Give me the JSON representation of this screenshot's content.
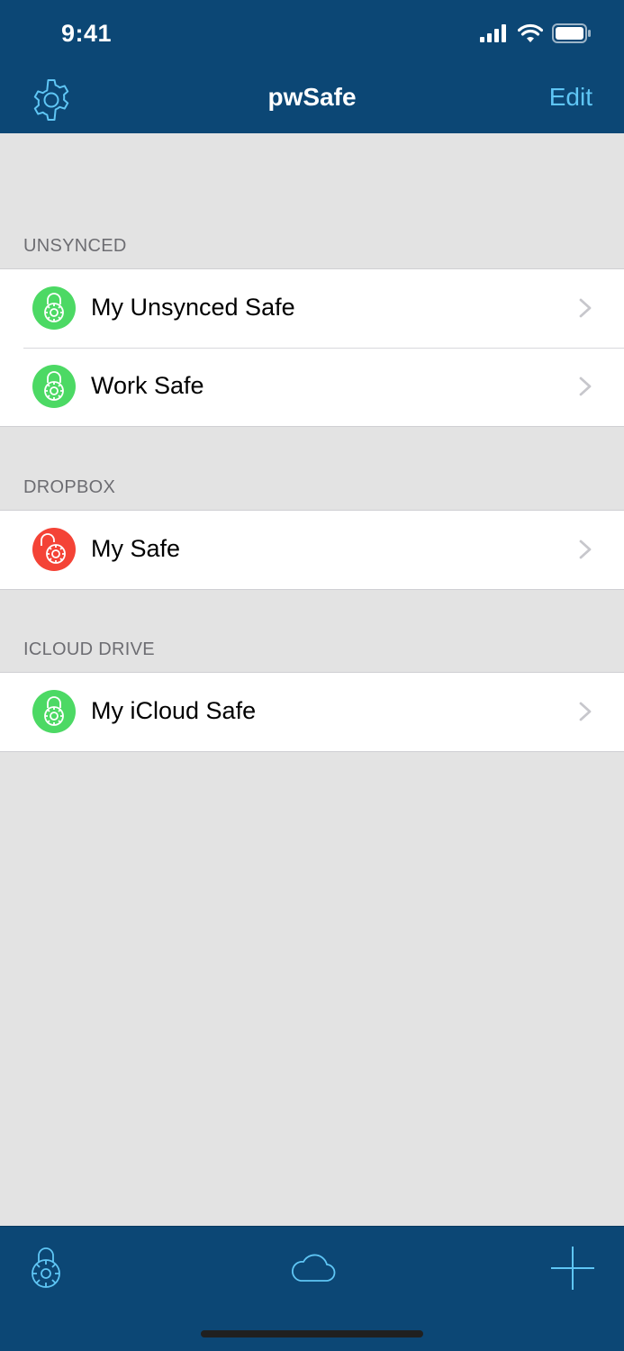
{
  "status_bar": {
    "time": "9:41"
  },
  "nav": {
    "title": "pwSafe",
    "edit_label": "Edit"
  },
  "sections": [
    {
      "header": "UNSYNCED",
      "items": [
        {
          "label": "My Unsynced Safe",
          "state": "locked"
        },
        {
          "label": "Work Safe",
          "state": "locked"
        }
      ]
    },
    {
      "header": "DROPBOX",
      "items": [
        {
          "label": "My Safe",
          "state": "unlocked"
        }
      ]
    },
    {
      "header": "ICLOUD DRIVE",
      "items": [
        {
          "label": "My iCloud Safe",
          "state": "locked"
        }
      ]
    }
  ],
  "tab_bar": {
    "icons": [
      "lock-icon",
      "cloud-icon",
      "add-icon"
    ]
  },
  "colors": {
    "bar": "#0c4775",
    "accent": "#5fc6f5",
    "locked": "#4cd964",
    "unlocked": "#f44336",
    "background": "#e3e3e3"
  }
}
